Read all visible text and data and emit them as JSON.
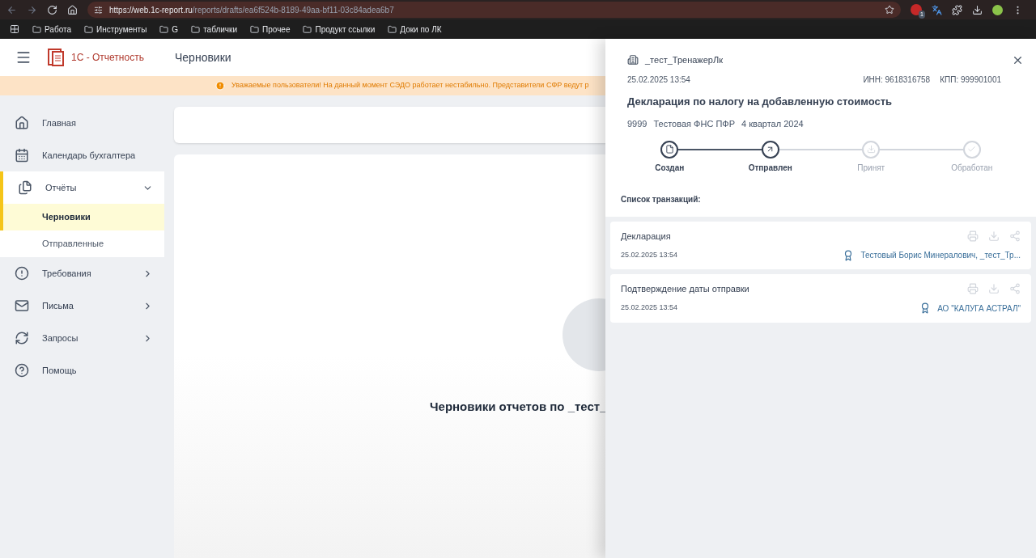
{
  "browser": {
    "url_host": "https://web.1c-report.ru",
    "url_path": "/reports/drafts/ea6f524b-8189-49aa-bf11-03c84adea6b7",
    "extension_badge": "1",
    "bookmarks": [
      "Работа",
      "Инструменты",
      "G",
      "таблички",
      "Прочее",
      "Продукт ссылки",
      "Доки по ЛК"
    ]
  },
  "header": {
    "logo_text": "1С - Отчетность",
    "page_title": "Черновики"
  },
  "banner": {
    "text": "Уважаемые пользователи! На данный момент СЭДО работает нестабильно. Представители СФР ведут р"
  },
  "sidebar": {
    "items": [
      {
        "label": "Главная",
        "kind": "link",
        "selected": false
      },
      {
        "label": "Календарь бухгалтера",
        "kind": "link",
        "selected": false
      },
      {
        "label": "Отчёты",
        "kind": "group",
        "expanded": true,
        "selected": true,
        "children": [
          {
            "label": "Черновики",
            "selected": true
          },
          {
            "label": "Отправленные",
            "selected": false
          }
        ]
      },
      {
        "label": "Требования",
        "kind": "group",
        "expanded": false,
        "selected": false
      },
      {
        "label": "Письма",
        "kind": "group",
        "expanded": false,
        "selected": false
      },
      {
        "label": "Запросы",
        "kind": "group",
        "expanded": false,
        "selected": false
      },
      {
        "label": "Помощь",
        "kind": "link",
        "selected": false
      }
    ]
  },
  "content": {
    "empty_title": "Черновики отчетов по _тест_"
  },
  "drawer": {
    "organization": "_тест_ТренажерЛк",
    "date": "25.02.2025 13:54",
    "inn": "ИНН: 9618316758",
    "kpp": "КПП: 999901001",
    "title": "Декларация по налогу на добавленную стоимость",
    "code": "9999",
    "authority": "Тестовая ФНС ПФР",
    "period": "4 квартал 2024",
    "steps": [
      {
        "label": "Создан",
        "kind": "created",
        "done": true
      },
      {
        "label": "Отправлен",
        "kind": "sent",
        "done": true
      },
      {
        "label": "Принят",
        "kind": "accepted",
        "done": false
      },
      {
        "label": "Обработан",
        "kind": "processed",
        "done": false
      }
    ],
    "transactions_label": "Список транзакций:",
    "transactions": [
      {
        "name": "Декларация",
        "date": "25.02.2025 13:54",
        "signer": "Тестовый Борис Минералович, _тест_Тр..."
      },
      {
        "name": "Подтверждение даты отправки",
        "date": "25.02.2025 13:54",
        "signer": "АО \"КАЛУГА АСТРАЛ\""
      }
    ]
  }
}
